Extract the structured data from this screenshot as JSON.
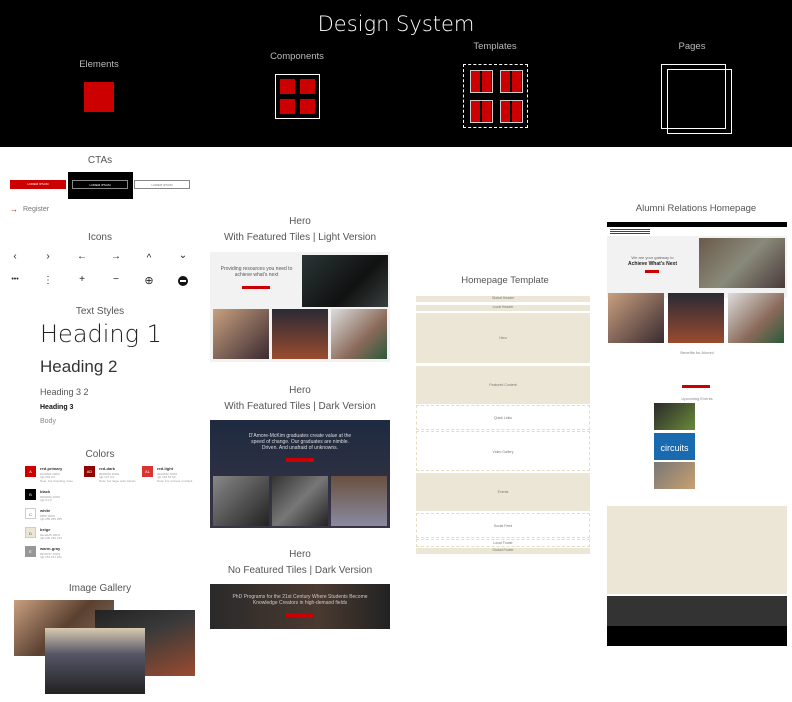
{
  "header": {
    "title": "Design System",
    "levels": [
      "Elements",
      "Components",
      "Templates",
      "Pages"
    ]
  },
  "ctas": {
    "title": "CTAs",
    "buttons": [
      "LOREM IPSUM",
      "LOREM IPSUM",
      "LOREM IPSUM"
    ],
    "link": "Register"
  },
  "icons": {
    "title": "Icons",
    "row1": [
      "‹",
      "›",
      "←",
      "→",
      "^",
      "⌄"
    ],
    "row2": [
      "•••",
      "⋮",
      "+",
      "−",
      "⊕",
      "⊖"
    ]
  },
  "text_styles": {
    "title": "Text Styles",
    "h1": "Heading 1",
    "h2": "Heading 2",
    "h32": "Heading 3 2",
    "h3": "Heading 3",
    "body": "Body"
  },
  "colors": {
    "title": "Colors",
    "items": [
      {
        "letter": "A",
        "name": "red-primary",
        "hex": "#cc0000 100%",
        "rgb": "rgb 204 0 0",
        "note": "Note: For branding, lines",
        "color": "#cc0000"
      },
      {
        "letter": "AD",
        "name": "red-dark",
        "hex": "#930000 100%",
        "rgb": "rgb 147 0 0",
        "note": "Note: For large color blocks",
        "color": "#930000"
      },
      {
        "letter": "AL",
        "name": "red-light",
        "hex": "#da3432 100%",
        "rgb": "rgb 218 52 50",
        "note": "Note: For red text on black",
        "color": "#da3432"
      },
      {
        "letter": "B",
        "name": "black",
        "hex": "#000000 100%",
        "rgb": "rgb 0 0 0",
        "note": "",
        "color": "#000000"
      },
      {
        "letter": "C",
        "name": "white",
        "hex": "#ffffff 100%",
        "rgb": "rgb 255 255 255",
        "note": "",
        "color": "#ffffff"
      },
      {
        "letter": "D",
        "name": "beige",
        "hex": "#ece6d5 100%",
        "rgb": "rgb 236 230 213",
        "note": "",
        "color": "#ece6d5"
      },
      {
        "letter": "E",
        "name": "warm-gray",
        "hex": "#979797 100%",
        "rgb": "rgb 151 151 151",
        "note": "",
        "color": "#979797"
      }
    ]
  },
  "gallery": {
    "title": "Image Gallery"
  },
  "heroes": [
    {
      "title": "Hero",
      "subtitle": "With Featured Tiles | Light Version",
      "text": "Providing resources you need to achieve what's next"
    },
    {
      "title": "Hero",
      "subtitle": "With Featured Tiles | Dark Version",
      "text": "D'Amore-McKim graduates create value at the speed of change. Our graduates are nimble. Driven. And unafraid of unknowns."
    },
    {
      "title": "Hero",
      "subtitle": "No Featured Tiles | Dark Version",
      "text": "PhD Programs for the 21st Century Where Students Become Knowledge Creators in high-demand fields"
    }
  ],
  "template": {
    "title": "Homepage Template",
    "blocks": [
      "Global Header",
      "Local Header",
      "Hero",
      "Featured Content",
      "Quick Links",
      "Video Gallery",
      "Events",
      "Social Feed",
      "Local Footer",
      "Global Footer"
    ]
  },
  "page": {
    "title": "Alumni Relations Homepage",
    "hero_line1": "We are your gateway to",
    "hero_line2": "Achieve What's Next",
    "benefits": "Benefits for Alumni",
    "events": "Upcoming Events",
    "circuits": "circuits"
  }
}
